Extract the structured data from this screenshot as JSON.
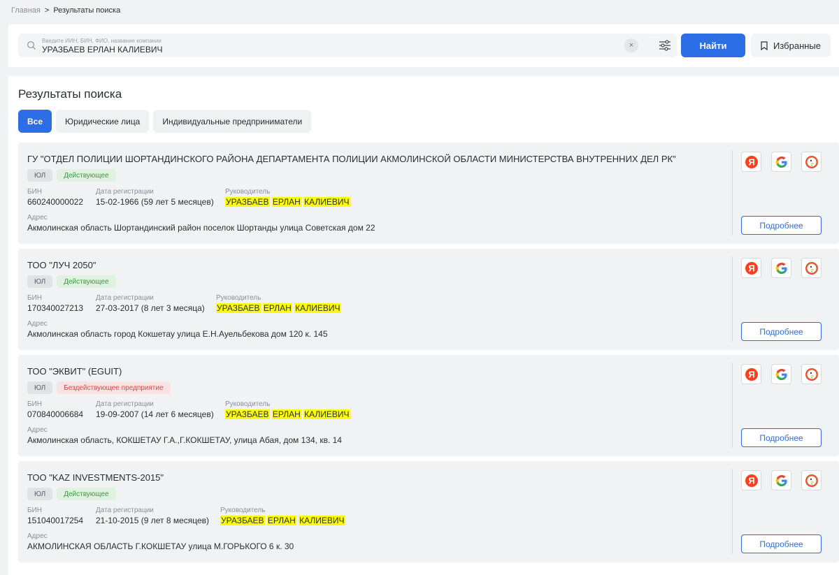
{
  "breadcrumb": {
    "home": "Главная",
    "separator": ">",
    "current": "Результаты поиска"
  },
  "search": {
    "placeholder": "Введите ИИН, БИН, ФИО, название компании",
    "value": "УРАЗБАЕВ ЕРЛАН КАЛИЕВИЧ",
    "clear_label": "×",
    "find_label": "Найти",
    "favorites_label": "Избранные"
  },
  "results": {
    "title": "Результаты поиска",
    "tabs": [
      {
        "label": "Все",
        "active": true
      },
      {
        "label": "Юридические лица",
        "active": false
      },
      {
        "label": "Индивидуальные предприниматели",
        "active": false
      }
    ]
  },
  "labels": {
    "bin": "БИН",
    "reg_date": "Дата регистрации",
    "head": "Руководитель",
    "address": "Адрес",
    "more": "Подробнее"
  },
  "highlight_colors": {
    "accent": "#2b6ee6",
    "highlight": "#ffff00"
  },
  "cards": [
    {
      "title": "ГУ \"ОТДЕЛ ПОЛИЦИИ ШОРТАНДИНСКОГО РАЙОНА ДЕПАРТАМЕНТА ПОЛИЦИИ АКМОЛИНСКОЙ ОБЛАСТИ МИНИСТЕРСТВА ВНУТРЕННИХ ДЕЛ РК\"",
      "type_badge": "ЮЛ",
      "status_badge": "Действующее",
      "status": "active",
      "bin": "660240000022",
      "reg_date": "15-02-1966 (59 лет 5 месяцев)",
      "head": [
        "УРАЗБАЕВ",
        "ЕРЛАН",
        "КАЛИЕВИЧ"
      ],
      "address": "Акмолинская область Шортандинский район поселок Шортанды улица Советская дом 22"
    },
    {
      "title": "ТОО \"ЛУЧ 2050\"",
      "type_badge": "ЮЛ",
      "status_badge": "Действующее",
      "status": "active",
      "bin": "170340027213",
      "reg_date": "27-03-2017 (8 лет 3 месяца)",
      "head": [
        "УРАЗБАЕВ",
        "ЕРЛАН",
        "КАЛИЕВИЧ"
      ],
      "address": "Акмолинская область город Кокшетау улица Е.Н.Ауельбекова дом 120 к. 145"
    },
    {
      "title": "ТОО \"ЭКВИТ\" (EGUIT)",
      "type_badge": "ЮЛ",
      "status_badge": "Бездействующее предприятие",
      "status": "inactive",
      "bin": "070840006684",
      "reg_date": "19-09-2007 (14 лет 6 месяцев)",
      "head": [
        "УРАЗБАЕВ",
        "ЕРЛАН",
        "КАЛИЕВИЧ"
      ],
      "address": "Акмолинская область, КОКШЕТАУ Г.А.,Г.КОКШЕТАУ, улица Абая, дом 134, кв. 14"
    },
    {
      "title": "ТОО \"KAZ INVESTMENTS-2015\"",
      "type_badge": "ЮЛ",
      "status_badge": "Действующее",
      "status": "active",
      "bin": "151040017254",
      "reg_date": "21-10-2015 (9 лет 8 месяцев)",
      "head": [
        "УРАЗБАЕВ",
        "ЕРЛАН",
        "КАЛИЕВИЧ"
      ],
      "address": "АКМОЛИНСКАЯ ОБЛАСТЬ Г.КОКШЕТАУ улица М.ГОРЬКОГО 6 к. 30"
    }
  ],
  "engine_icons": [
    "yandex-icon",
    "google-icon",
    "duckduckgo-icon"
  ]
}
